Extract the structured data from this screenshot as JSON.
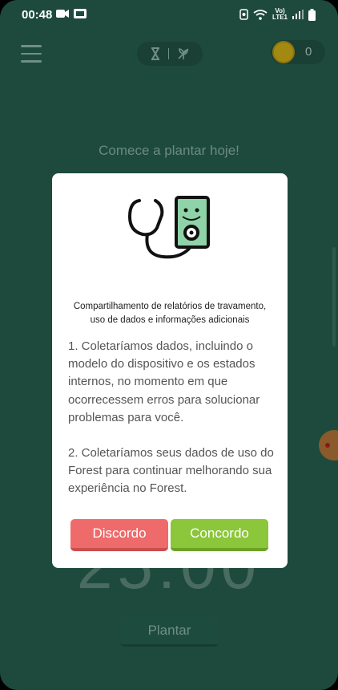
{
  "status_bar": {
    "time": "00:48",
    "left_icons": [
      "video-call-icon",
      "sim-card-icon"
    ],
    "right_icons": [
      "alarm-icon",
      "wifi-icon",
      "volte-icon",
      "signal-icon",
      "battery-icon"
    ],
    "volte_label": "Vo)\nLTE1"
  },
  "app": {
    "coin_count": "0",
    "headline": "Comece a plantar hoje!",
    "timer": "25:00",
    "plant_label": "Plantar"
  },
  "dialog": {
    "title": "Compartilhamento de relatórios de travamento, uso de dados e informações adicionais",
    "paragraphs": [
      "1. Coletaríamos dados, incluindo o modelo do dispositivo e os estados internos, no momento em que ocorrecessem erros para solucionar problemas para você.",
      "2. Coletaríamos seus dados de uso do Forest para continuar melhorando sua experiência no Forest."
    ],
    "disagree_label": "Discordo",
    "agree_label": "Concordo"
  },
  "colors": {
    "background": "#1e4a3d",
    "disagree": "#ef6b6b",
    "agree": "#8cc63a"
  }
}
